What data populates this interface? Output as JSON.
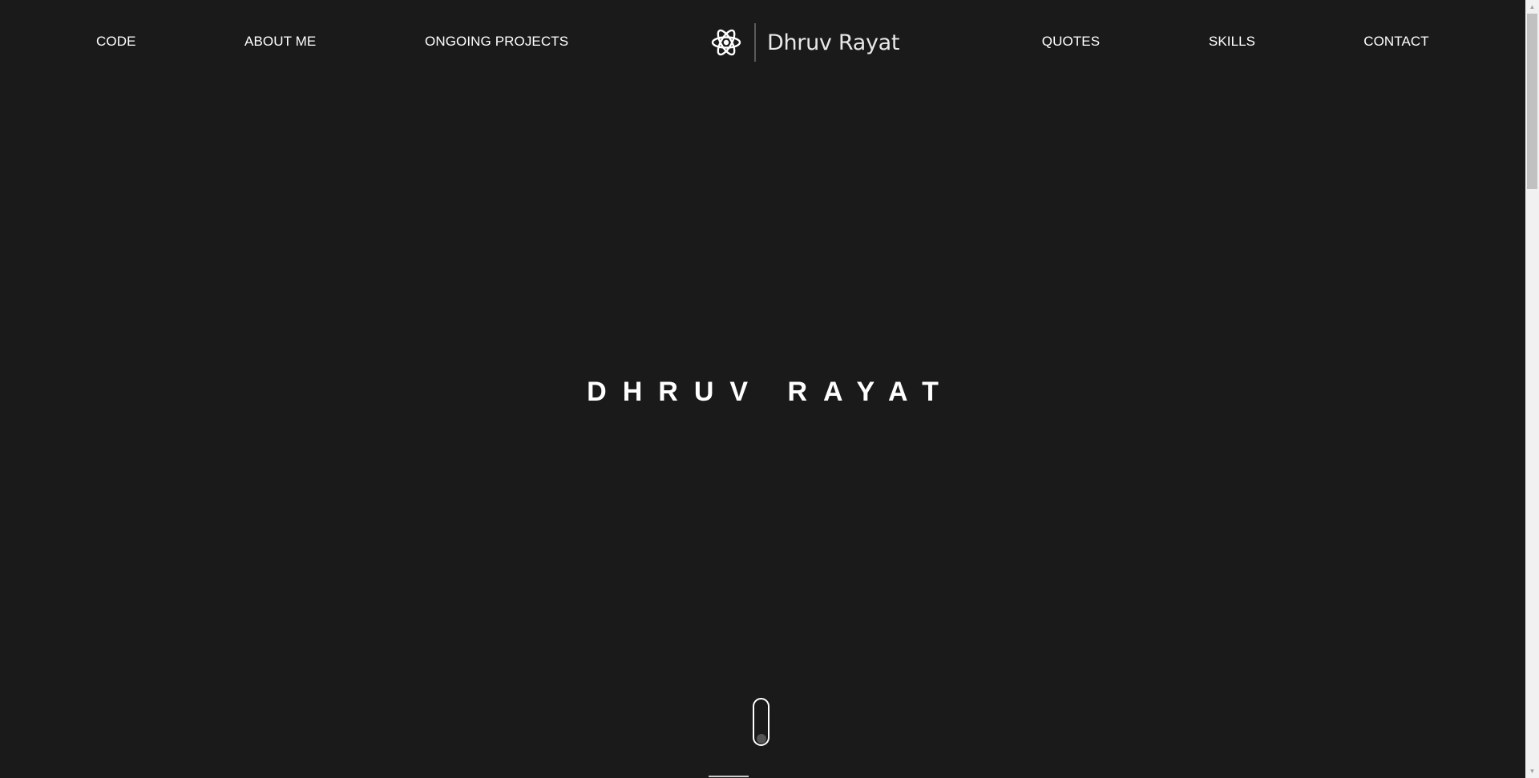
{
  "nav": {
    "left": [
      {
        "label": "CODE"
      },
      {
        "label": "ABOUT ME"
      },
      {
        "label": "ONGOING PROJECTS"
      }
    ],
    "right": [
      {
        "label": "QUOTES"
      },
      {
        "label": "SKILLS"
      },
      {
        "label": "CONTACT"
      }
    ],
    "logo": {
      "icon": "atom-icon",
      "text": "Dhruv Rayat"
    }
  },
  "hero": {
    "title": "DHRUV RAYAT"
  },
  "scroll_indicator": {
    "icon": "mouse-scroll-icon"
  },
  "colors": {
    "background": "#1a1a1a",
    "text": "#ffffff",
    "divider": "#5a5a5a",
    "scrollbar_track": "#f1f1f1",
    "scrollbar_thumb": "#c1c1c1"
  }
}
